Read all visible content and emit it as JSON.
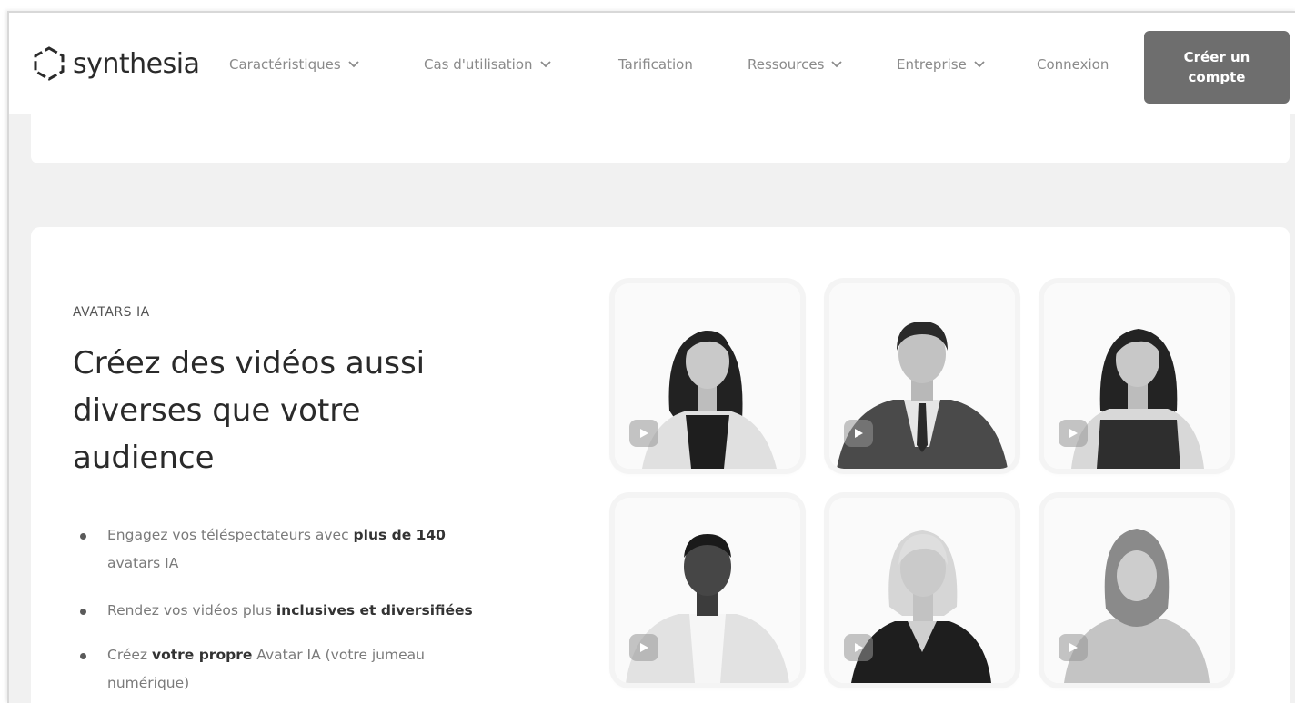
{
  "header": {
    "brand": "synthesia",
    "nav": [
      {
        "label": "Caractéristiques",
        "dropdown": true
      },
      {
        "label": "Cas d'utilisation",
        "dropdown": true
      },
      {
        "label": "Tarification",
        "dropdown": false
      },
      {
        "label": "Ressources",
        "dropdown": true
      },
      {
        "label": "Entreprise",
        "dropdown": true
      },
      {
        "label": "Connexion",
        "dropdown": false
      }
    ],
    "cta_label": "Créer un compte"
  },
  "section": {
    "eyebrow": "AVATARS IA",
    "headline": "Créez des vidéos aussi diverses que votre audience",
    "bullets": [
      {
        "before": "Engagez vos téléspectateurs avec ",
        "bold": "plus de 140",
        "after": " avatars IA"
      },
      {
        "before": "Rendez vos vidéos plus ",
        "bold": "inclusives et diversifiées",
        "after": ""
      },
      {
        "before": "Créez ",
        "bold": "votre propre",
        "after": " Avatar IA (votre jumeau numérique)"
      }
    ]
  },
  "avatars": [
    {
      "icon": "avatar-woman-long-hair-icon"
    },
    {
      "icon": "avatar-man-suit-icon"
    },
    {
      "icon": "avatar-woman-dark-hair-icon"
    },
    {
      "icon": "avatar-man-shirt-icon"
    },
    {
      "icon": "avatar-woman-blonde-icon"
    },
    {
      "icon": "avatar-woman-hijab-icon"
    }
  ],
  "colors": {
    "cta": "#6e6e6e",
    "page_bg": "#f1f1f1",
    "card_bg": "#ffffff"
  }
}
